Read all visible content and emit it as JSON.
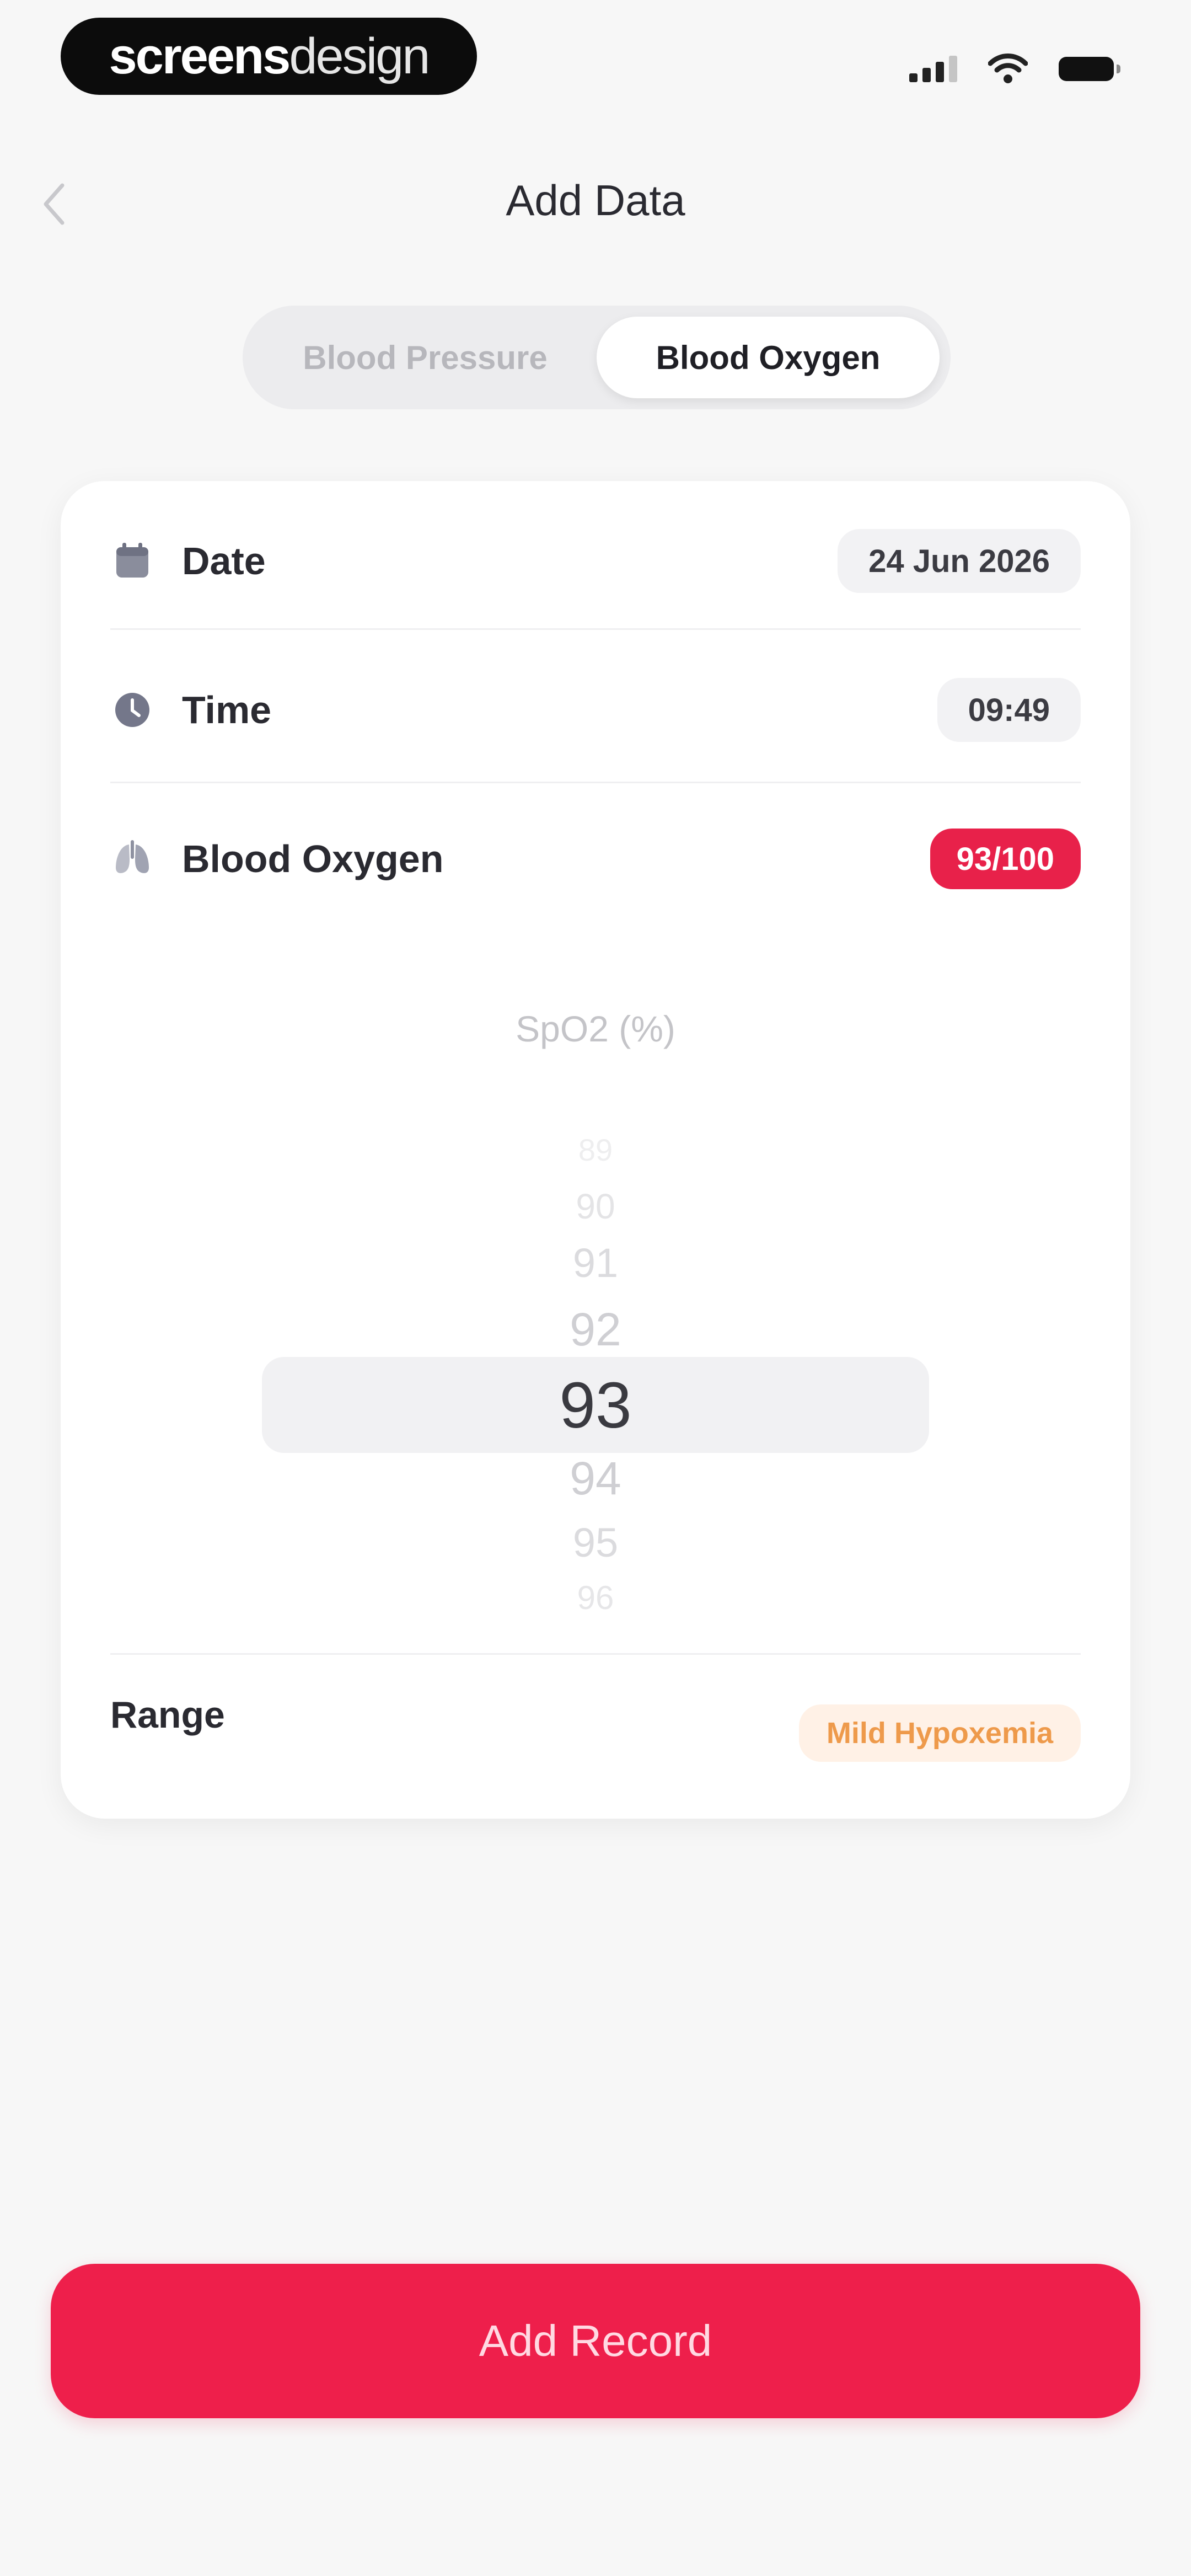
{
  "status_bar": {
    "brand": {
      "bold": "screens",
      "light": "design"
    }
  },
  "header": {
    "title": "Add Data",
    "back_icon": "chevron-left-icon"
  },
  "tabs": [
    {
      "label": "Blood Pressure",
      "active": false
    },
    {
      "label": "Blood Oxygen",
      "active": true
    }
  ],
  "form": {
    "date": {
      "label": "Date",
      "value": "24 Jun 2026",
      "icon": "calendar-icon"
    },
    "time": {
      "label": "Time",
      "value": "09:49",
      "icon": "clock-icon"
    },
    "oxygen": {
      "label": "Blood Oxygen",
      "value": "93/100",
      "icon": "lungs-icon"
    },
    "picker": {
      "label": "SpO2 (%)",
      "items": [
        "89",
        "90",
        "91",
        "92",
        "93",
        "94",
        "95",
        "96"
      ],
      "selected": "93"
    },
    "range": {
      "label": "Range",
      "value": "Mild Hypoxemia"
    }
  },
  "colors": {
    "accent": "#EE1F4B",
    "warning_text": "#EE9A4B",
    "warning_bg": "#FFF1E6"
  },
  "actions": {
    "add_record": "Add Record"
  }
}
